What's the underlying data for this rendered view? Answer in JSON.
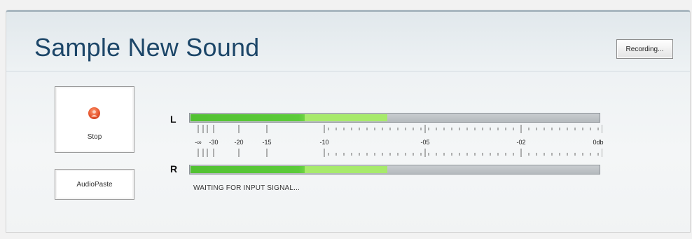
{
  "panel": {
    "title": "Sample New Sound",
    "recording_button": "Recording..."
  },
  "controls": {
    "stop_label": "Stop",
    "stop_icon": "record-stop-icon",
    "audiopaste_label": "AudioPaste"
  },
  "meter": {
    "left_label": "L",
    "right_label": "R",
    "left_level": 0.48,
    "right_level": 0.48,
    "scale_labels": [
      "-∞",
      "-30",
      "-20",
      "-15",
      "-10",
      "-05",
      "-02",
      "0db"
    ],
    "status": "WAITING FOR INPUT SIGNAL..."
  },
  "colors": {
    "title": "#1c4668",
    "meter_green": "#5bcb39",
    "meter_highlight": "#a7ea6b",
    "stop_icon": "#e6542c"
  }
}
